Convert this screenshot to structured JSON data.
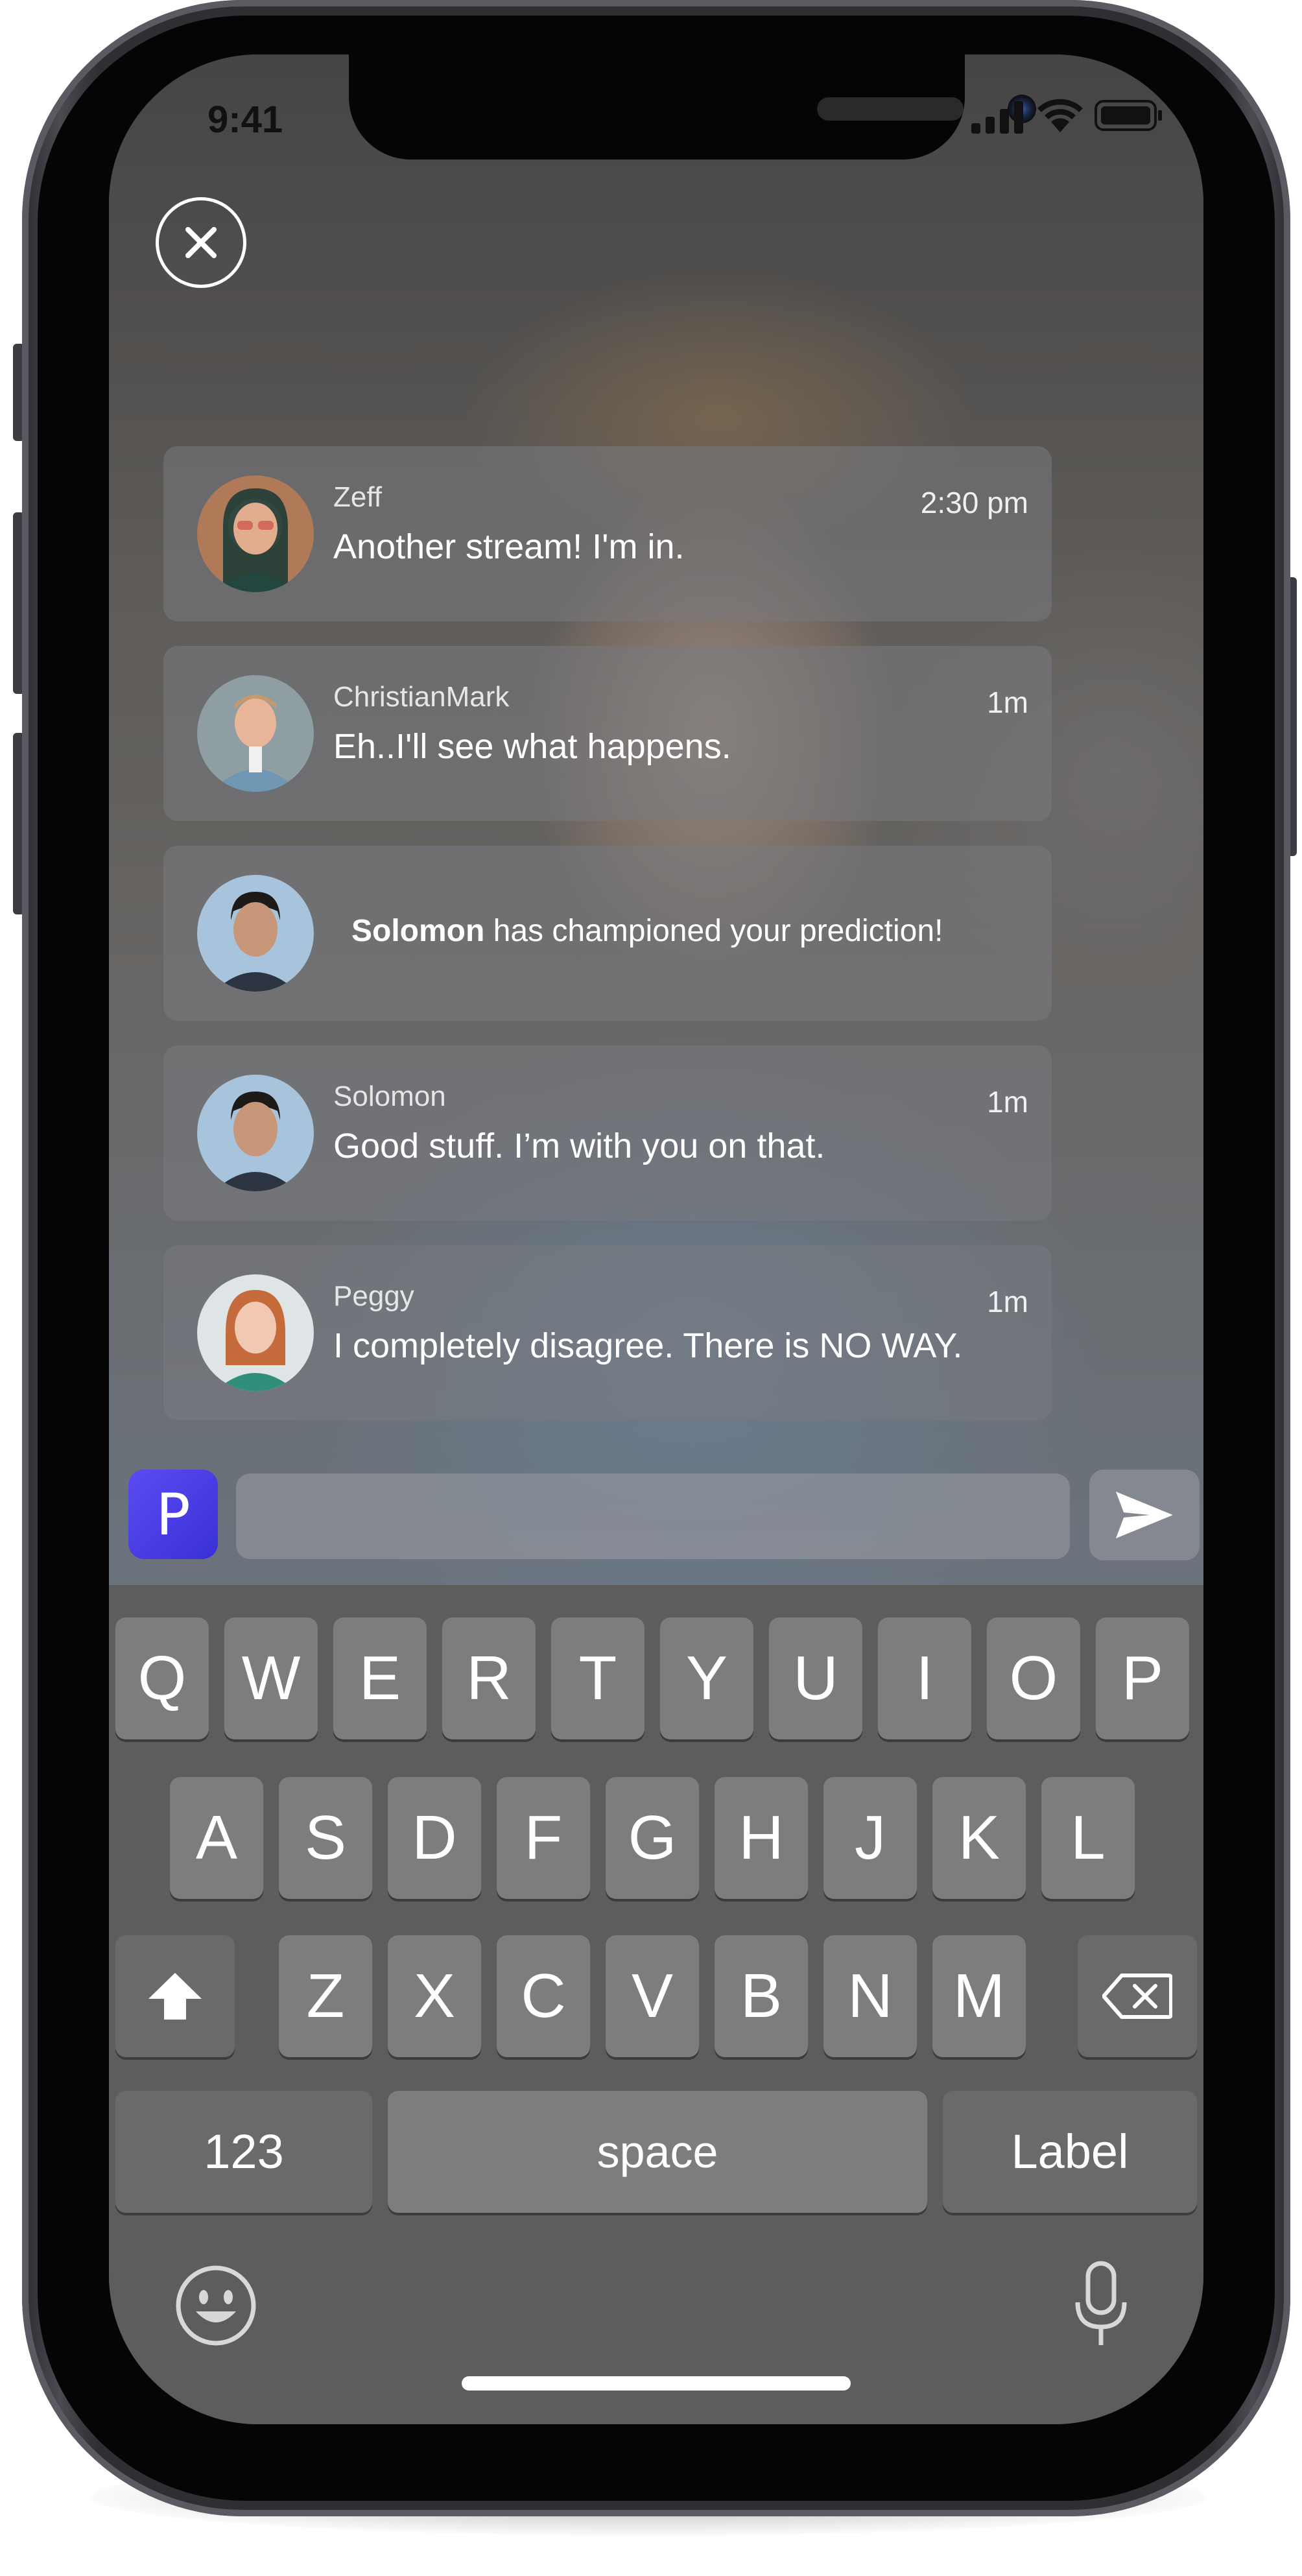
{
  "status_bar": {
    "time": "9:41"
  },
  "messages": [
    {
      "type": "chat",
      "name": "Zeff",
      "time": "2:30 pm",
      "text": "Another stream! I'm in."
    },
    {
      "type": "chat",
      "name": "ChristianMark",
      "time": "1m",
      "text": "Eh..I'll see what happens."
    },
    {
      "type": "notice",
      "actor": "Solomon",
      "text": " has championed your prediction!"
    },
    {
      "type": "chat",
      "name": "Solomon",
      "time": "1m",
      "text": "Good stuff. I’m with you on that."
    },
    {
      "type": "chat",
      "name": "Peggy",
      "time": "1m",
      "text": "I completely disagree. There is NO WAY."
    }
  ],
  "composer": {
    "logo_letter": "P",
    "value": ""
  },
  "keyboard": {
    "row1": [
      "Q",
      "W",
      "E",
      "R",
      "T",
      "Y",
      "U",
      "I",
      "O",
      "P"
    ],
    "row2": [
      "A",
      "S",
      "D",
      "F",
      "G",
      "H",
      "J",
      "K",
      "L"
    ],
    "row3": [
      "Z",
      "X",
      "C",
      "V",
      "B",
      "N",
      "M"
    ],
    "numbers_key": "123",
    "space_key": "space",
    "return_key": "Label"
  },
  "colors": {
    "accent": "#4a3ee6",
    "bubble": "#7a7c82",
    "keyboard_bg": "#5d5d5d",
    "key_bg": "#7d7d7d"
  },
  "icons": [
    "close-icon",
    "send-icon",
    "shift-icon",
    "delete-icon",
    "emoji-icon",
    "microphone-icon",
    "signal-icon",
    "wifi-icon",
    "battery-icon"
  ]
}
